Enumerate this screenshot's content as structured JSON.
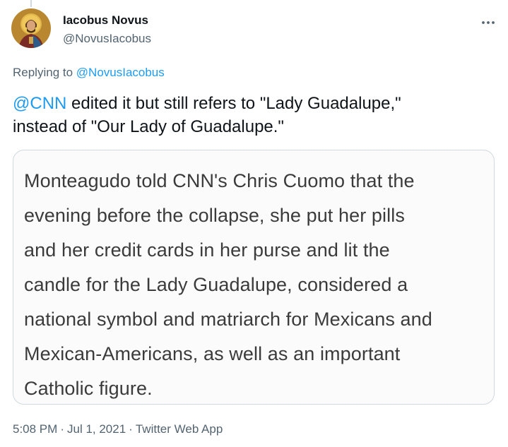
{
  "author": {
    "name": "Iacobus Novus",
    "handle": "@NovusIacobus"
  },
  "reply": {
    "prefix": "Replying to ",
    "mention": "@NovusIacobus"
  },
  "tweet": {
    "mention": "@CNN",
    "text_line1": " edited it but still refers to \"Lady Guadalupe,\"",
    "text_line2": "instead of \"Our Lady of Guadalupe.\""
  },
  "media": {
    "text": "Monteagudo told CNN's Chris Cuomo that the\nevening before the collapse, she put her pills\nand her credit cards in her purse and lit the\ncandle for the Lady Guadalupe, considered a\nnational symbol and matriarch for Mexicans and\nMexican-Americans, as well as an important\nCatholic figure."
  },
  "meta": {
    "time": "5:08 PM",
    "date": "Jul 1, 2021",
    "source": "Twitter Web App",
    "separator": "·"
  },
  "icons": {
    "more": "more-horizontal-icon",
    "avatar": "saint-icon-avatar"
  },
  "colors": {
    "link": "#1d9bf0",
    "secondary_text": "#536471",
    "primary_text": "#0f1419",
    "border": "#cfd9de"
  }
}
